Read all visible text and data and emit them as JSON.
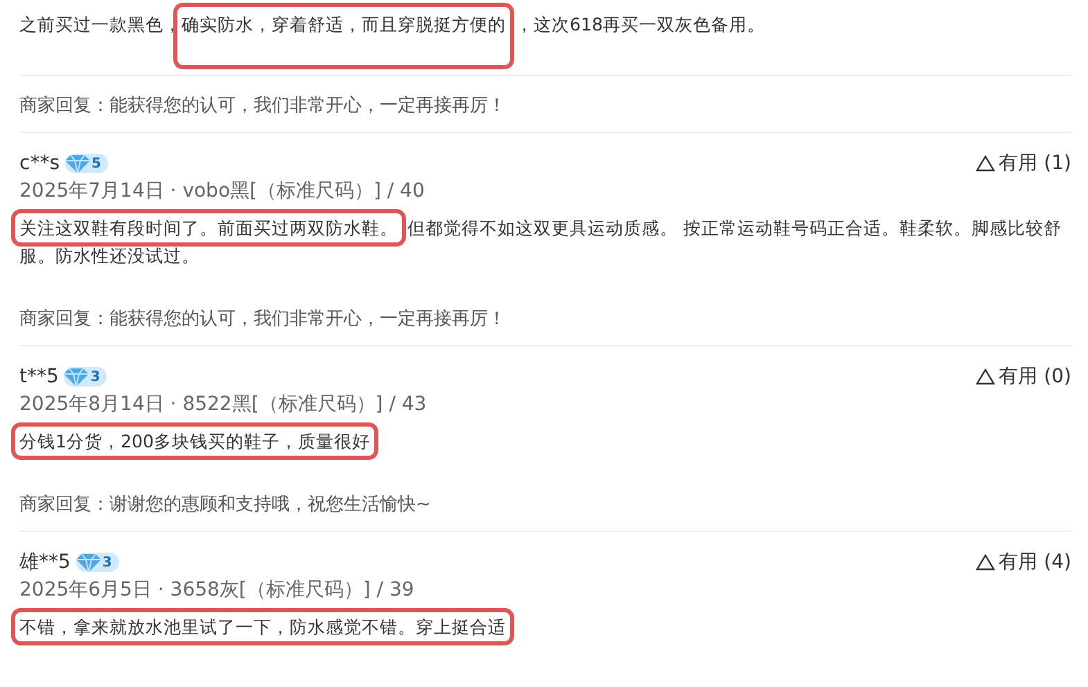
{
  "first_review": {
    "segments": [
      {
        "text": "之前买过一款黑色，",
        "highlighted": false
      },
      {
        "text": "确实防水，穿着舒适，而且穿脱挺方便的",
        "highlighted": true
      },
      {
        "text": "，这次618再买一双灰色备用。",
        "highlighted": false
      }
    ],
    "reply": "商家回复：能获得您的认可，我们非常开心，一定再接再厉！"
  },
  "reviews": [
    {
      "user": "c**s",
      "level": "5",
      "useful": "有用 (1)",
      "meta": "2025年7月14日 · vobo黑[（标准尺码）] / 40",
      "segments": [
        {
          "text": "关注这双鞋有段时间了。前面买过两双防水鞋。",
          "highlighted": true
        },
        {
          "text": "但都觉得不如这双更具运动质感。 按正常运动鞋号码正合适。鞋柔软。脚感比较舒服。防水性还没试过。",
          "highlighted": false
        }
      ],
      "reply": "商家回复：能获得您的认可，我们非常开心，一定再接再厉！"
    },
    {
      "user": "t**5",
      "level": "3",
      "useful": "有用 (0)",
      "meta": "2025年8月14日 · 8522黑[（标准尺码）] / 43",
      "segments": [
        {
          "text": "分钱1分货，200多块钱买的鞋子，质量很好",
          "highlighted": true
        }
      ],
      "reply": "商家回复：谢谢您的惠顾和支持哦，祝您生活愉快~"
    },
    {
      "user": "雄**5",
      "level": "3",
      "useful": "有用 (4)",
      "meta": "2025年6月5日 · 3658灰[（标准尺码）] / 39",
      "segments": [
        {
          "text": "不错，拿来就放水池里试了一下，防水感觉不错。穿上挺合适",
          "highlighted": true
        }
      ]
    }
  ]
}
